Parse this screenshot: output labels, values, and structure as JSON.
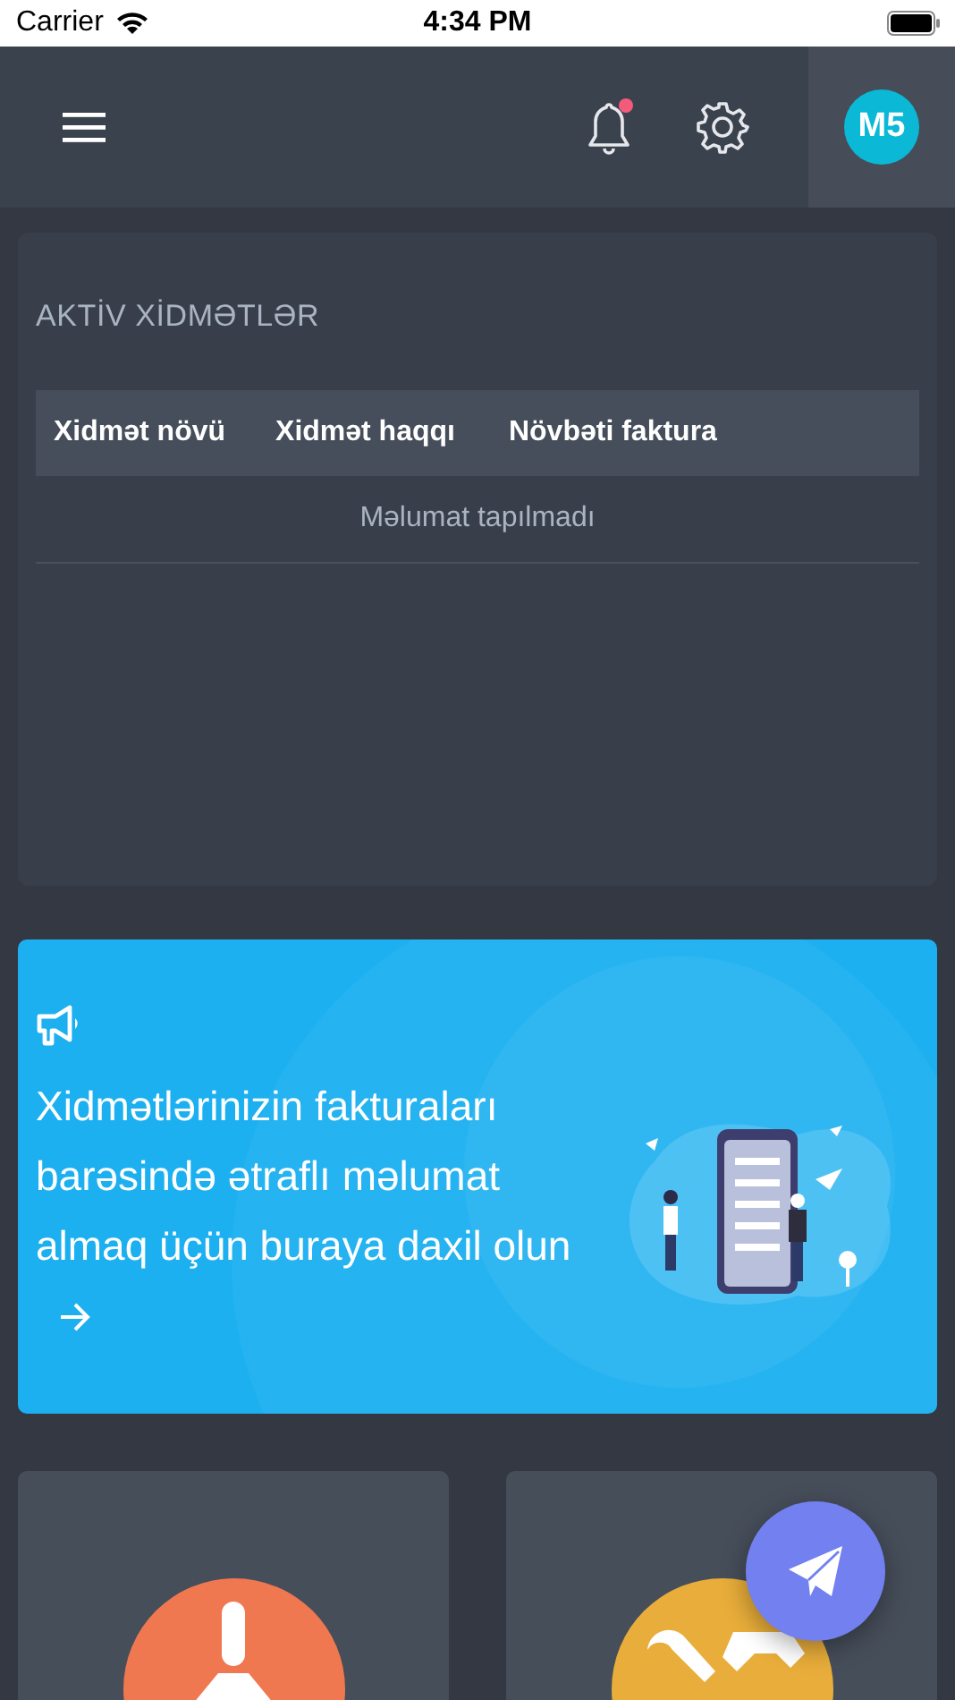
{
  "status_bar": {
    "carrier": "Carrier",
    "time": "4:34 PM"
  },
  "header": {
    "notifications": {
      "unread": true
    },
    "avatar": "M5"
  },
  "services_card": {
    "title": "AKTİV XİDMƏTLƏR",
    "columns": [
      "Xidmət növü",
      "Xidmət haqqı",
      "Növbəti faktura"
    ],
    "empty_message": "Məlumat tapılmadı"
  },
  "banner": {
    "text": "Xidmətlərinizin fakturaları barəsində ətraflı məlumat almaq üçün buraya daxil olun"
  },
  "tiles": [
    {
      "kind": "broom",
      "color": "#f07850"
    },
    {
      "kind": "tools",
      "color": "#e8ad3a"
    }
  ]
}
